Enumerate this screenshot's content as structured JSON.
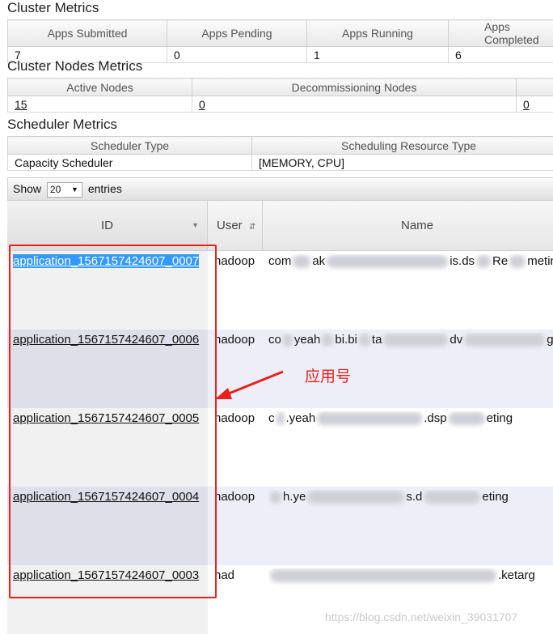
{
  "cluster_metrics": {
    "title": "Cluster Metrics",
    "headers": [
      "Apps Submitted",
      "Apps Pending",
      "Apps Running",
      "Apps Completed"
    ],
    "values": [
      "7",
      "0",
      "1",
      "6"
    ]
  },
  "nodes_metrics": {
    "title": "Cluster Nodes Metrics",
    "headers": [
      "Active Nodes",
      "Decommissioning Nodes",
      ""
    ],
    "values": [
      "15",
      "0",
      "0"
    ]
  },
  "scheduler_metrics": {
    "title": "Scheduler Metrics",
    "headers": [
      "Scheduler Type",
      "Scheduling Resource Type"
    ],
    "values": [
      "Capacity Scheduler",
      "[MEMORY, CPU]"
    ]
  },
  "entries_control": {
    "show_label": "Show",
    "selected": "20",
    "entries_label": "entries"
  },
  "apps_table": {
    "columns": {
      "id": "ID",
      "user": "User",
      "name": "Name"
    },
    "rows": [
      {
        "id": "application_1567157424607_0007",
        "user": "hadoop",
        "name_parts": [
          "com",
          "ak",
          "is.ds",
          "Re",
          "meting"
        ]
      },
      {
        "id": "application_1567157424607_0006",
        "user": "hadoop",
        "name_parts": [
          "co",
          "yeah",
          "bi.bi",
          "ta",
          "dv",
          "g"
        ]
      },
      {
        "id": "application_1567157424607_0005",
        "user": "hadoop",
        "name_parts": [
          "c",
          ".yeah",
          ".dsp",
          "eting"
        ]
      },
      {
        "id": "application_1567157424607_0004",
        "user": "hadoop",
        "name_parts": [
          "h.ye",
          "s.d",
          "eting"
        ]
      },
      {
        "id": "application_1567157424607_0003",
        "user": "had",
        "name_parts": [
          ".ketarg"
        ]
      }
    ]
  },
  "annotation": {
    "text": "应用号"
  },
  "watermark": {
    "text": "https://blog.csdn.net/weixin_39031707"
  },
  "colors": {
    "highlight": "#e8211b",
    "selection": "#3399ff"
  }
}
